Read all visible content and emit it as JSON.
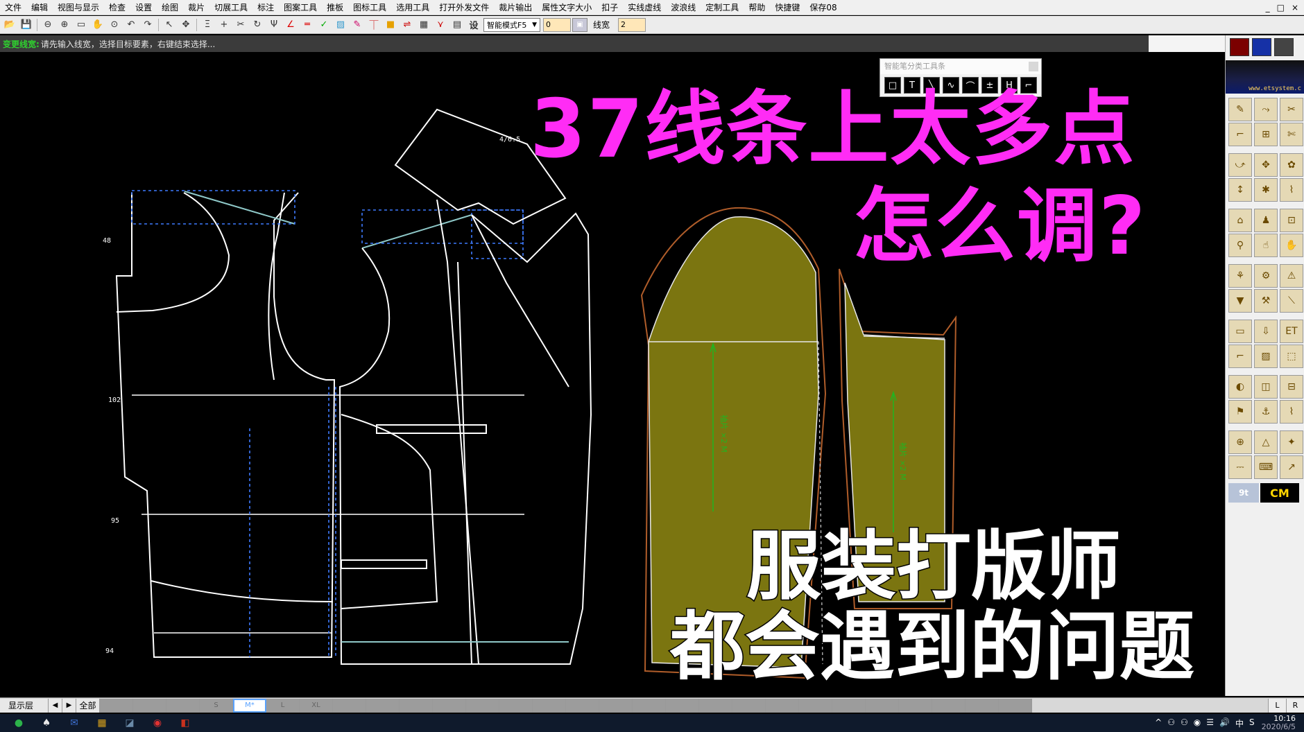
{
  "menu": [
    "文件",
    "编辑",
    "视图与显示",
    "检查",
    "设置",
    "绘图",
    "裁片",
    "切展工具",
    "标注",
    "图案工具",
    "推板",
    "图标工具",
    "选用工具",
    "打开外发文件",
    "裁片输出",
    "属性文字大小",
    "扣子",
    "实线虚线",
    "波浪线",
    "定制工具",
    "帮助",
    "快捷键",
    "保存08"
  ],
  "window_controls": [
    "_",
    "□",
    "×"
  ],
  "toolbar": {
    "settings_label": "设",
    "mode_select": "智能模式F5",
    "value_input": "0",
    "line_width_label": "线宽",
    "line_width_value": "2"
  },
  "prompt": {
    "key": "变更线宽:",
    "text": "请先输入线宽，选择目标要素，右键结束选择..."
  },
  "float_toolbar": {
    "title": "智能笔分类工具条",
    "icons": [
      "□",
      "T",
      "╲",
      "∿",
      "⌒",
      "±",
      "H",
      "⌐"
    ]
  },
  "overlay": {
    "line1": "37线条上太多点",
    "line2": "怎么调?",
    "line3": "服装打版师",
    "line4": "都会遇到的问题"
  },
  "pattern_labels": {
    "top_label": "4/6.5",
    "measure_48": "48",
    "measure_102": "102",
    "measure_95": "95",
    "measure_94": "94",
    "sleeve_text_a": "袖片 ×2 M",
    "sleeve_text_b": "袖片 ×2 M"
  },
  "palette": {
    "brand": "www.etsystem.c",
    "unit_left": "9t",
    "unit_right": "CM",
    "tool_icons": [
      "✎",
      "⤳",
      "✂",
      "⌐",
      "⊞",
      "✄",
      "⤻",
      "✥",
      "✿",
      "↕",
      "✱",
      "⌇",
      "⌂",
      "♟",
      "⊡",
      "⚲",
      "☝",
      "✋",
      "⚘",
      "⚙",
      "⚠",
      "▼",
      "⚒",
      "⟍",
      "▭",
      "⇩",
      "ET",
      "⌐",
      "▨",
      "⬚",
      "◐",
      "◫",
      "⊟",
      "⚑",
      "⚓",
      "⌇",
      "⊕",
      "△",
      "✦",
      "⎓",
      "⌨",
      "↗"
    ]
  },
  "layerbar": {
    "label": "显示层",
    "prev": "◀",
    "next": "▶",
    "all": "全部",
    "cells": [
      "",
      "",
      "",
      "S",
      "M*",
      "L",
      "XL",
      "",
      "",
      "",
      "",
      "",
      "",
      "",
      "",
      "",
      "",
      "",
      "",
      "",
      "",
      "",
      "",
      "",
      "",
      "",
      "",
      ""
    ],
    "left": "L",
    "right": "R"
  },
  "taskbar": {
    "apps": [
      "●",
      "♠",
      "✉",
      "▦",
      "◪",
      "◉",
      "◧"
    ],
    "tray": [
      "^",
      "⚇",
      "⚇",
      "◉",
      "☰",
      "🔊",
      "中",
      "S"
    ],
    "time": "10:16",
    "date": "2020/6/5"
  },
  "colors": {
    "accent_magenta": "#ff2cf5",
    "pattern_line": "#ffffff",
    "sleeve_fill": "#7b7510",
    "sleeve_outline": "#b05d2a",
    "grain_line": "#21b521",
    "dash_blue": "#3e7bff"
  }
}
